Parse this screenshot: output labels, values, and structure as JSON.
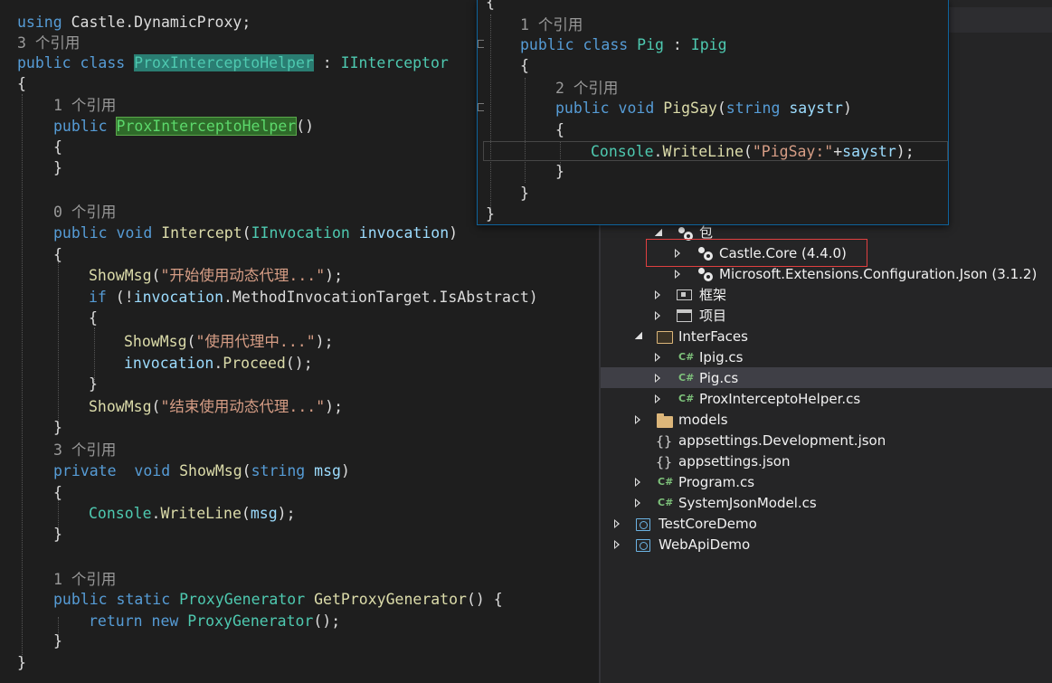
{
  "editor": {
    "lines": {
      "l1": {
        "kw": "using",
        "ns": "Castle.DynamicProxy;"
      },
      "l2": {
        "ref": "3 个引用"
      },
      "l3": {
        "kw1": "public",
        "kw2": "class",
        "cls": "ProxInterceptoHelper",
        "colon": " : ",
        "iface": "IInterceptor"
      },
      "l4": {
        "brace": "{"
      },
      "l5": {
        "ref": "1 个引用"
      },
      "l6": {
        "kw": "public",
        "ctor": "ProxInterceptoHelper",
        "paren": "()"
      },
      "l7": {
        "brace": "{"
      },
      "l8": {
        "brace": "}"
      },
      "l9": {
        "ref": "0 个引用"
      },
      "l10": {
        "kw1": "public",
        "kw2": "void",
        "fn": "Intercept",
        "p1": "(",
        "ty": "IInvocation",
        "arg": "invocation",
        "p2": ")"
      },
      "l11": {
        "brace": "{"
      },
      "l12": {
        "fn": "ShowMsg",
        "p1": "(",
        "str": "\"开始使用动态代理...\"",
        "p2": ");"
      },
      "l13": {
        "kw": "if",
        "p1": " (!",
        "id1": "invocation",
        "dot1": ".",
        "m1": "MethodInvocationTarget",
        "dot2": ".",
        "m2": "IsAbstract",
        "p2": ")"
      },
      "l14": {
        "brace": "{"
      },
      "l15": {
        "fn": "ShowMsg",
        "p1": "(",
        "str": "\"使用代理中...\"",
        "p2": ");"
      },
      "l16": {
        "id": "invocation",
        "dot": ".",
        "fn": "Proceed",
        "p": "();"
      },
      "l17": {
        "brace": "}"
      },
      "l18": {
        "fn": "ShowMsg",
        "p1": "(",
        "str": "\"结束使用动态代理...\"",
        "p2": ");"
      },
      "l19": {
        "brace": "}"
      },
      "l20": {
        "ref": "3 个引用"
      },
      "l21": {
        "kw1": "private",
        "kw2": "void",
        "fn": "ShowMsg",
        "p1": "(",
        "kw3": "string",
        "arg": "msg",
        "p2": ")"
      },
      "l22": {
        "brace": "{"
      },
      "l23": {
        "ty": "Console",
        "dot": ".",
        "fn": "WriteLine",
        "p1": "(",
        "arg": "msg",
        "p2": ");"
      },
      "l24": {
        "brace": "}"
      },
      "l25": {
        "ref": "1 个引用"
      },
      "l26": {
        "kw1": "public",
        "kw2": "static",
        "ty": "ProxyGenerator",
        "fn": "GetProxyGenerator",
        "p": "() {"
      },
      "l27": {
        "kw1": "return",
        "kw2": "new",
        "ty": "ProxyGenerator",
        "p": "();"
      },
      "l28": {
        "brace": "}"
      },
      "l29": {
        "brace": "}"
      }
    }
  },
  "peek": {
    "top_brace": "{",
    "ref1": "1 个引用",
    "class_kw1": "public",
    "class_kw2": "class",
    "class_name": "Pig",
    "class_colon": " : ",
    "class_iface": "Ipig",
    "open_brace": "{",
    "ref2": "2 个引用",
    "m_kw1": "public",
    "m_kw2": "void",
    "m_name": "PigSay",
    "m_p1": "(",
    "m_kw3": "string",
    "m_arg": "saystr",
    "m_p2": ")",
    "m_open": "{",
    "body_ty": "Console",
    "body_dot": ".",
    "body_fn": "WriteLine",
    "body_p1": "(",
    "body_str": "\"PigSay:\"",
    "body_plus": "+",
    "body_arg": "saystr",
    "body_p2": ");",
    "m_close": "}",
    "class_close": "}",
    "outer_close": "}"
  },
  "solution_explorer": {
    "items": [
      {
        "label": "包",
        "icon": "package-icon"
      },
      {
        "label": "Castle.Core (4.4.0)",
        "icon": "nuget-icon"
      },
      {
        "label": "Microsoft.Extensions.Configuration.Json (3.1.2)",
        "icon": "nuget-icon"
      },
      {
        "label": "框架",
        "icon": "framework-icon"
      },
      {
        "label": "项目",
        "icon": "project-icon"
      },
      {
        "label": "InterFaces",
        "icon": "folder-open-icon"
      },
      {
        "label": "Ipig.cs",
        "icon": "csharp-icon"
      },
      {
        "label": "Pig.cs",
        "icon": "csharp-icon"
      },
      {
        "label": "ProxInterceptoHelper.cs",
        "icon": "csharp-icon"
      },
      {
        "label": "models",
        "icon": "folder-icon"
      },
      {
        "label": "appsettings.Development.json",
        "icon": "json-icon"
      },
      {
        "label": "appsettings.json",
        "icon": "json-icon"
      },
      {
        "label": "Program.cs",
        "icon": "csharp-icon"
      },
      {
        "label": "SystemJsonModel.cs",
        "icon": "csharp-icon"
      },
      {
        "label": "TestCoreDemo",
        "icon": "web-project-icon"
      },
      {
        "label": "WebApiDemo",
        "icon": "web-project-icon"
      }
    ],
    "cs_glyph": "C#",
    "json_glyph": "{}"
  },
  "colors": {
    "keyword": "#569cd6",
    "type": "#4ec9b0",
    "method": "#dcdcaa",
    "identifier": "#9cdcfe",
    "string": "#d69d85",
    "highlight_box": "#e04040"
  }
}
